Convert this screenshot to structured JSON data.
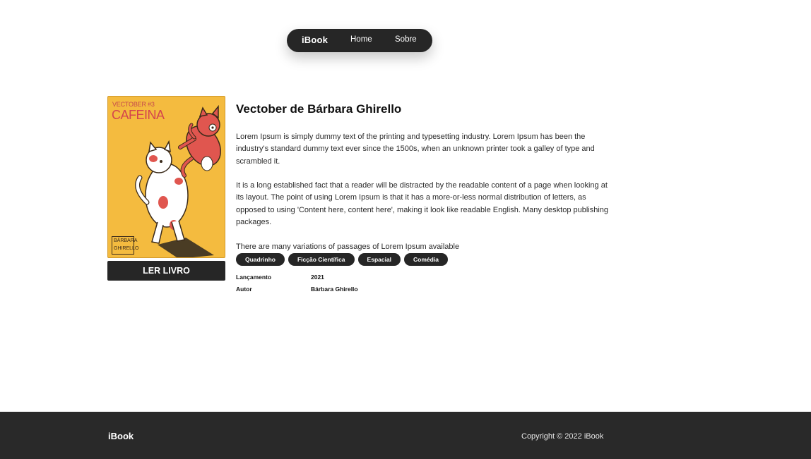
{
  "nav": {
    "logo": "iBook",
    "links": [
      "Home",
      "Sobre"
    ]
  },
  "book": {
    "cover": {
      "series": "VECTOBER #3",
      "title": "CAFEINA",
      "author_mark": "BÁRBARA GHIRELLO"
    },
    "read_button": "LER LIVRO",
    "title": "Vectober de Bárbara Ghirello",
    "paragraphs": [
      "Lorem Ipsum is simply dummy text of the printing and typesetting industry. Lorem Ipsum has been the industry's standard dummy text ever since the 1500s, when an unknown printer took a galley of type and scrambled it.",
      "It is a long established fact that a reader will be distracted by the readable content of a page when looking at its layout. The point of using Lorem Ipsum is that it has a more-or-less normal distribution of letters, as opposed to using 'Content here, content here', making it look like readable English. Many desktop publishing packages.",
      "There are many variations of passages of Lorem Ipsum available"
    ],
    "tags": [
      "Quadrinho",
      "Ficção Científica",
      "Espacial",
      "Comédia"
    ],
    "meta": {
      "release_label": "Lançamento",
      "release_value": "2021",
      "author_label": "Autor",
      "author_value": "Bárbara Ghirello"
    }
  },
  "footer": {
    "logo": "iBook",
    "copyright": "Copyright © 2022 iBook"
  },
  "colors": {
    "dark": "#262626",
    "cover_bg": "#f4bb3f",
    "cat_red": "#e0564f",
    "footer_bg": "#292929"
  }
}
